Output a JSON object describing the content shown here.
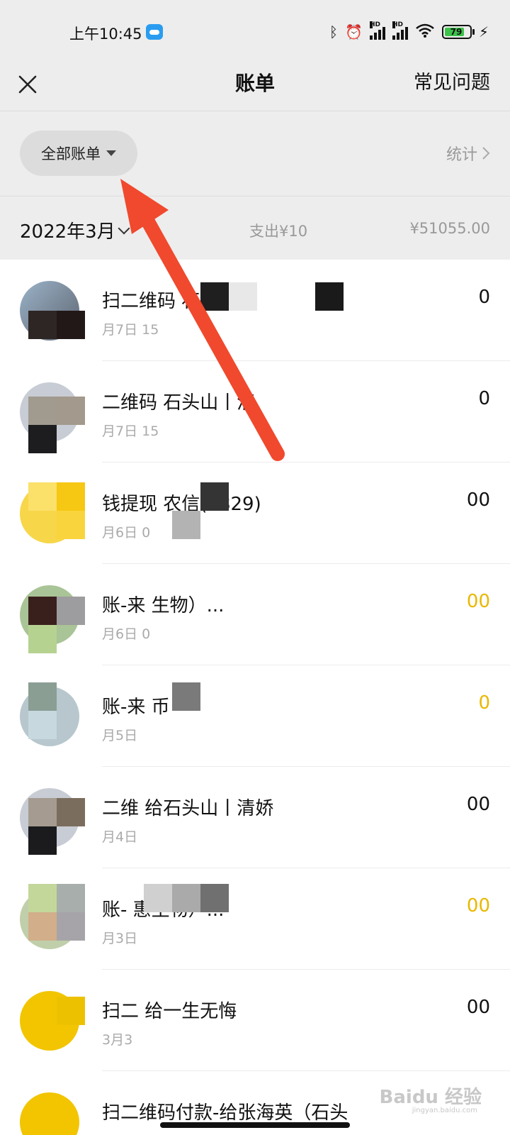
{
  "status": {
    "time": "上午10:45",
    "battery": "79"
  },
  "nav": {
    "title": "账单",
    "faq": "常见问题"
  },
  "filter": {
    "label": "全部账单",
    "stats": "统计"
  },
  "month": {
    "label": "2022年3月",
    "spend": "支出¥10",
    "income": "¥51055.00"
  },
  "rows": [
    {
      "title": "扫二维码  石头山",
      "date": "月7日 15",
      "amount": "0",
      "income": false
    },
    {
      "title": "二维码  石头山丨清",
      "date": "月7日 15",
      "amount": "0",
      "income": false
    },
    {
      "title": "钱提现  农信(5829)",
      "date": "月6日 0",
      "amount": "00",
      "income": false
    },
    {
      "title": "账-来  生物）...",
      "date": "月6日 0",
      "amount": "00",
      "income": true
    },
    {
      "title": "账-来  币",
      "date": "月5日",
      "amount": "0",
      "income": true
    },
    {
      "title": "二维  给石头山丨清娇",
      "date": "月4日",
      "amount": "00",
      "income": false
    },
    {
      "title": "账-  惠生物）...",
      "date": "月3日",
      "amount": "00",
      "income": true
    },
    {
      "title": "扫二  给一生无悔",
      "date": "3月3",
      "amount": "00",
      "income": false
    },
    {
      "title": "扫二维码付款-给张海英（石头",
      "date": "",
      "amount": "",
      "income": false
    }
  ],
  "watermark": {
    "brand": "Baidu 经验",
    "url": "jingyan.baidu.com"
  },
  "colors": {
    "background": "#ededed",
    "income": "#e9b800",
    "arrow": "#f0492e"
  }
}
